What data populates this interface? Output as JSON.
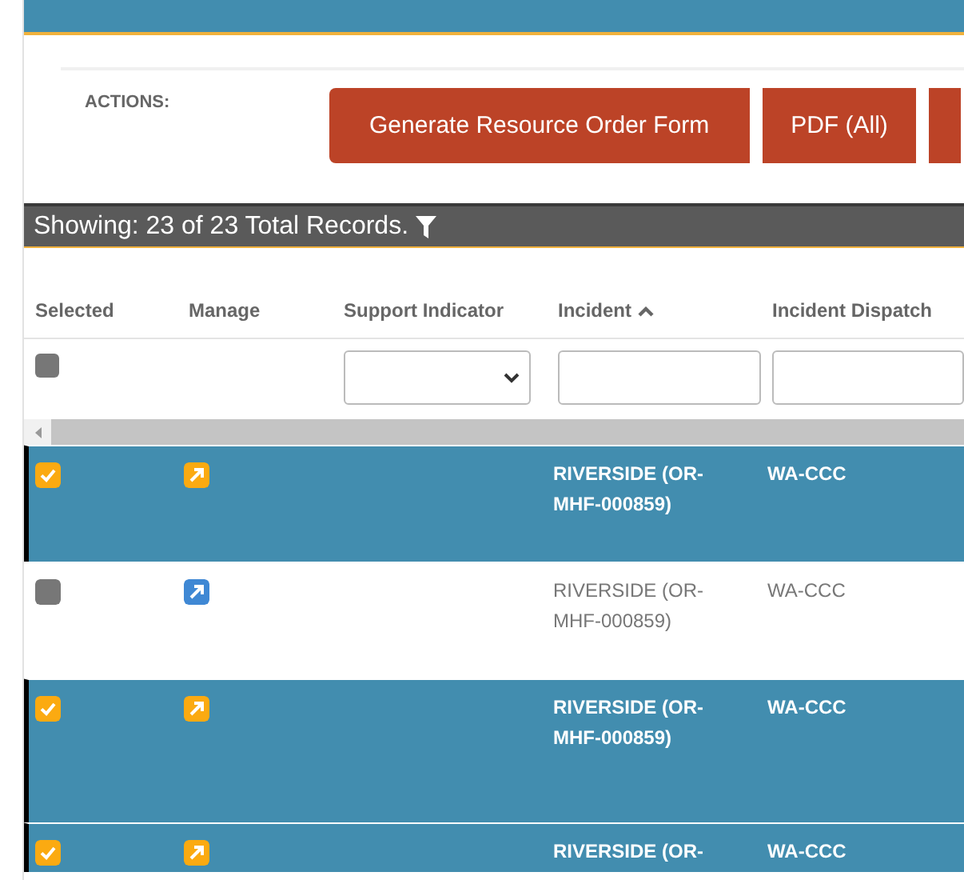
{
  "actions": {
    "label": "ACTIONS:",
    "buttons": [
      {
        "label": "Generate Resource Order Form"
      },
      {
        "label": "PDF (All)"
      }
    ],
    "more_buttons_cut": true
  },
  "records_bar": {
    "text": "Showing: 23 of 23 Total Records.",
    "filter_icon": true
  },
  "columns": [
    {
      "label": "Selected",
      "sorted_ascending": false,
      "filter": {
        "kind": "checkbox",
        "checked": false
      }
    },
    {
      "label": "Manage",
      "sorted_ascending": false,
      "filter": {
        "kind": "empty"
      }
    },
    {
      "label": "Support Indicator",
      "sorted_ascending": false,
      "filter": {
        "kind": "dropdown"
      }
    },
    {
      "label": "Incident",
      "sorted_ascending": true,
      "filter": {
        "kind": "field"
      }
    },
    {
      "label": "Incident Dispatch",
      "sorted_ascending": false,
      "filter": {
        "kind": "field"
      }
    }
  ],
  "rows": [
    {
      "selected": true,
      "incident": "RIVERSIDE (OR-MHF-000859)",
      "dispatch": "WA-CCC"
    },
    {
      "selected": false,
      "incident": "RIVERSIDE (OR-MHF-000859)",
      "dispatch": "WA-CCC"
    },
    {
      "selected": true,
      "incident": "RIVERSIDE (OR-MHF-000859)",
      "dispatch": "WA-CCC"
    },
    {
      "selected": true,
      "incident": "RIVERSIDE (OR-",
      "dispatch": "WA-CCC"
    }
  ]
}
